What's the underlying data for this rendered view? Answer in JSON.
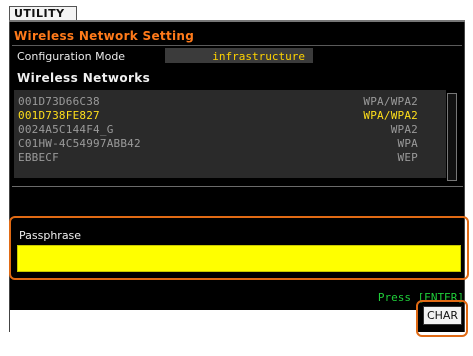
{
  "tab": {
    "label": "UTILITY"
  },
  "screen": {
    "title": "Wireless Network Setting",
    "configuration_mode": {
      "label": "Configuration Mode",
      "value": "infrastructure"
    },
    "networks_heading": "Wireless Networks",
    "networks": [
      {
        "ssid": "001D73D66C38",
        "security": "WPA/WPA2",
        "selected": false
      },
      {
        "ssid": "001D738FE827",
        "security": "WPA/WPA2",
        "selected": true
      },
      {
        "ssid": "0024A5C144F4_G",
        "security": "WPA2",
        "selected": false
      },
      {
        "ssid": "C01HW-4C54997ABB42",
        "security": "WPA",
        "selected": false
      },
      {
        "ssid": "EBBECF",
        "security": "WEP",
        "selected": false
      }
    ],
    "passphrase": {
      "label": "Passphrase",
      "value": ""
    },
    "hint": "Press [ENTER]",
    "char_button": "CHAR"
  },
  "colors": {
    "title": "#ff7a1a",
    "selected_row": "#ffdf1a",
    "input_background": "#ffff00",
    "hint": "#1fcf3a",
    "highlight_frame": "#e06a14"
  }
}
